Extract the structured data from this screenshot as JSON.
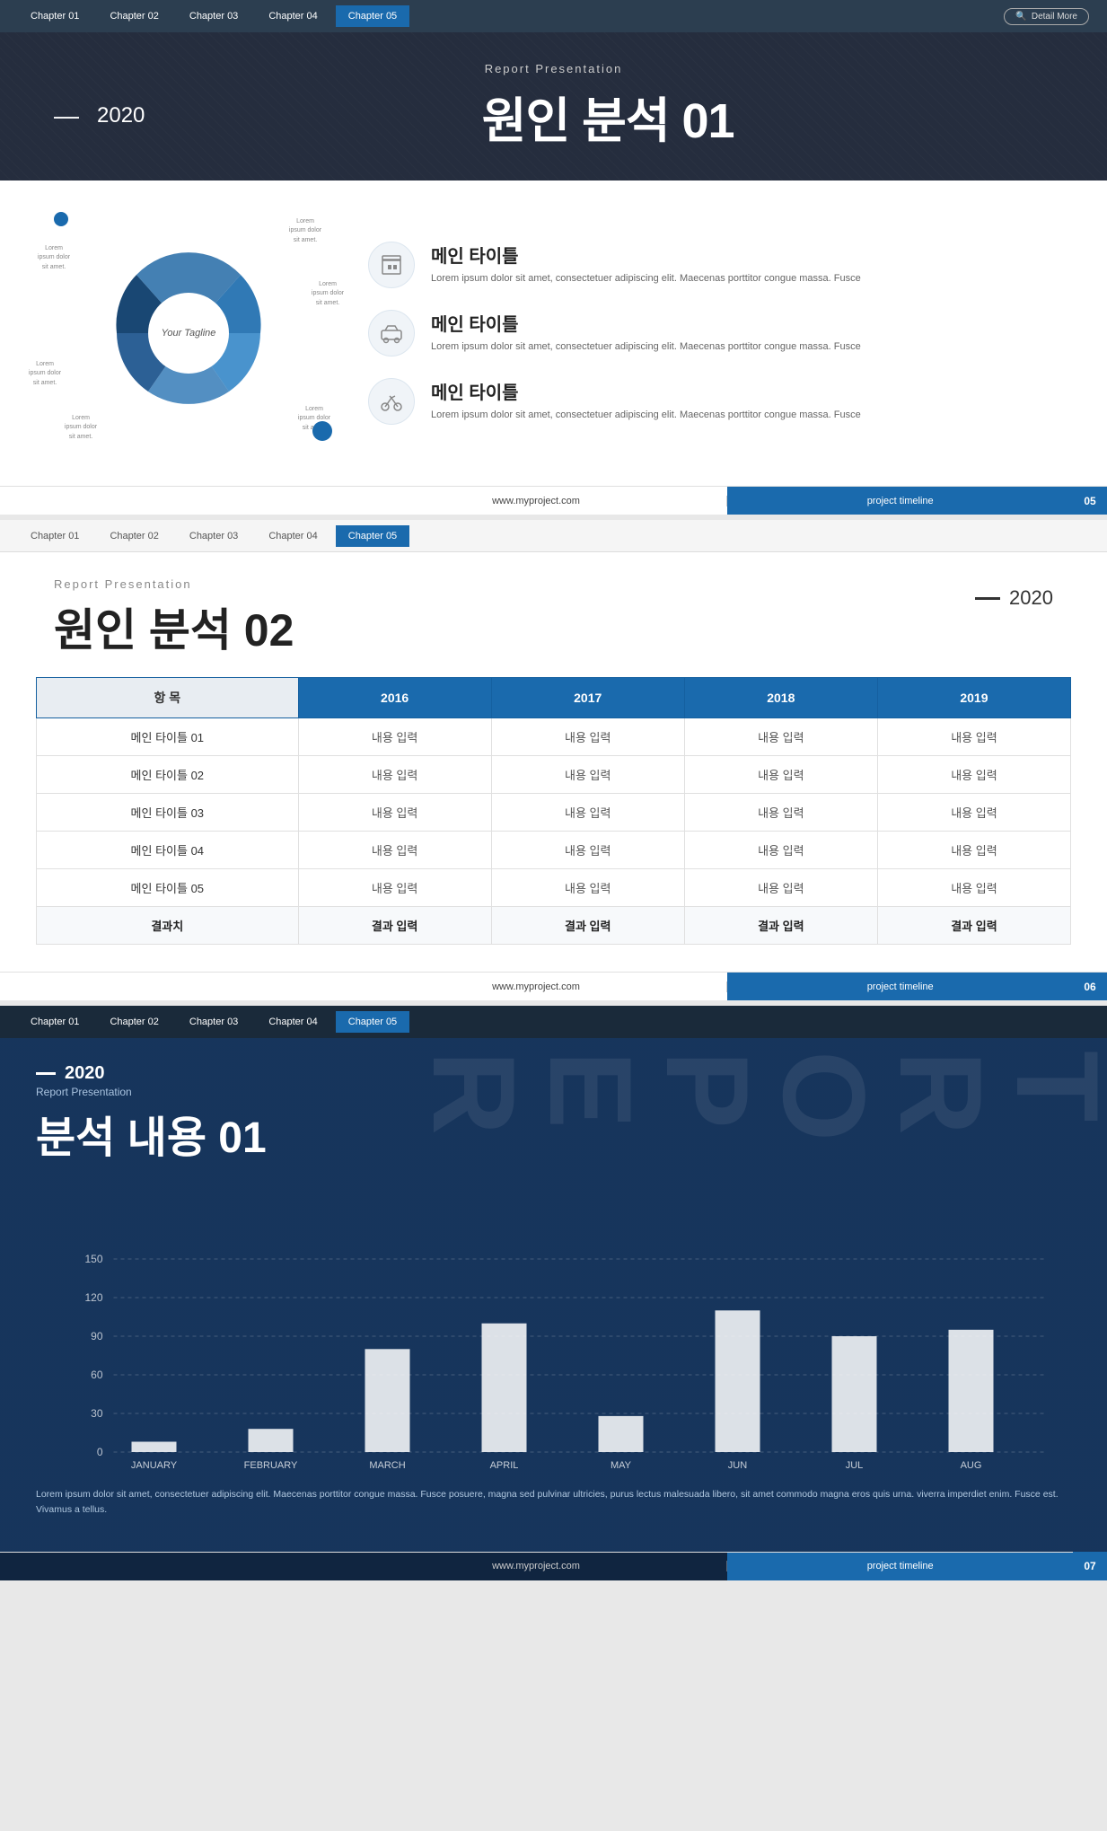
{
  "nav": {
    "tabs": [
      "Chapter 01",
      "Chapter 02",
      "Chapter 03",
      "Chapter 04",
      "Chapter 05"
    ],
    "activeIndex": 4,
    "detailMore": "Detail More"
  },
  "slide1": {
    "subtitle": "Report Presentation",
    "year": "2020",
    "title": "원인 분석 01",
    "chart": {
      "centerLabel": "Your Tagline",
      "labels": [
        "Lorem ipsum dolor sit amet.",
        "Lorem ipsum dolor sit amet.",
        "Lorem ipsum dolor sit amet.",
        "Lorem ipsum dolor sit amet.",
        "Lorem ipsum dolor sit amet.",
        "Lorem ipsum dolor sit amet."
      ]
    },
    "items": [
      {
        "icon": "building",
        "title": "메인 타이틀",
        "body": "Lorem ipsum dolor sit amet, consectetuer adipiscing elit.\nMaecenas porttitor congue massa. Fusce"
      },
      {
        "icon": "car",
        "title": "메인 타이틀",
        "body": "Lorem ipsum dolor sit amet, consectetuer adipiscing elit.\nMaecenas porttitor congue massa. Fusce"
      },
      {
        "icon": "bike",
        "title": "메인 타이틀",
        "body": "Lorem ipsum dolor sit amet, consectetuer adipiscing elit.\nMaecenas porttitor congue massa. Fusce"
      }
    ],
    "footer": {
      "url": "www.myproject.com",
      "tag": "project timeline",
      "pageNum": "05"
    }
  },
  "slide2": {
    "subtitle": "Report Presentation",
    "year": "2020",
    "title": "원인 분석 02",
    "table": {
      "headers": [
        "항 목",
        "2016",
        "2017",
        "2018",
        "2019"
      ],
      "rows": [
        [
          "메인 타이틀 01",
          "내용 입력",
          "내용 입력",
          "내용 입력",
          "내용 입력"
        ],
        [
          "메인 타이틀 02",
          "내용 입력",
          "내용 입력",
          "내용 입력",
          "내용 입력"
        ],
        [
          "메인 타이틀 03",
          "내용 입력",
          "내용 입력",
          "내용 입력",
          "내용 입력"
        ],
        [
          "메인 타이틀 04",
          "내용 입력",
          "내용 입력",
          "내용 입력",
          "내용 입력"
        ],
        [
          "메인 타이틀 05",
          "내용 입력",
          "내용 입력",
          "내용 입력",
          "내용 입력"
        ],
        [
          "결과치",
          "결과 입력",
          "결과 입력",
          "결과 입력",
          "결과 입력"
        ]
      ]
    },
    "footer": {
      "url": "www.myproject.com",
      "tag": "project timeline",
      "pageNum": "06"
    }
  },
  "slide3": {
    "year": "2020",
    "subtitle": "Report Presentation",
    "title": "분석 내용 01",
    "bgText": "REPORT",
    "chart": {
      "yLabels": [
        "0",
        "30",
        "60",
        "90",
        "120",
        "150"
      ],
      "xLabels": [
        "JANUARY",
        "FEBRUARY",
        "MARCH",
        "APRIL",
        "MAY",
        "JUN",
        "JUL",
        "AUG"
      ],
      "bars": [
        8,
        18,
        80,
        100,
        28,
        110,
        90,
        95
      ]
    },
    "desc": "Lorem ipsum dolor sit amet, consectetuer adipiscing elit. Maecenas porttitor congue massa. Fusce posuere, magna sed pulvinar ultricies, purus\nlectus malesuada libero, sit amet commodo magna eros quis urna. viverra imperdiet enim. Fusce est. Vivamus a tellus.",
    "footer": {
      "url": "www.myproject.com",
      "tag": "project timeline",
      "pageNum": "07"
    }
  }
}
